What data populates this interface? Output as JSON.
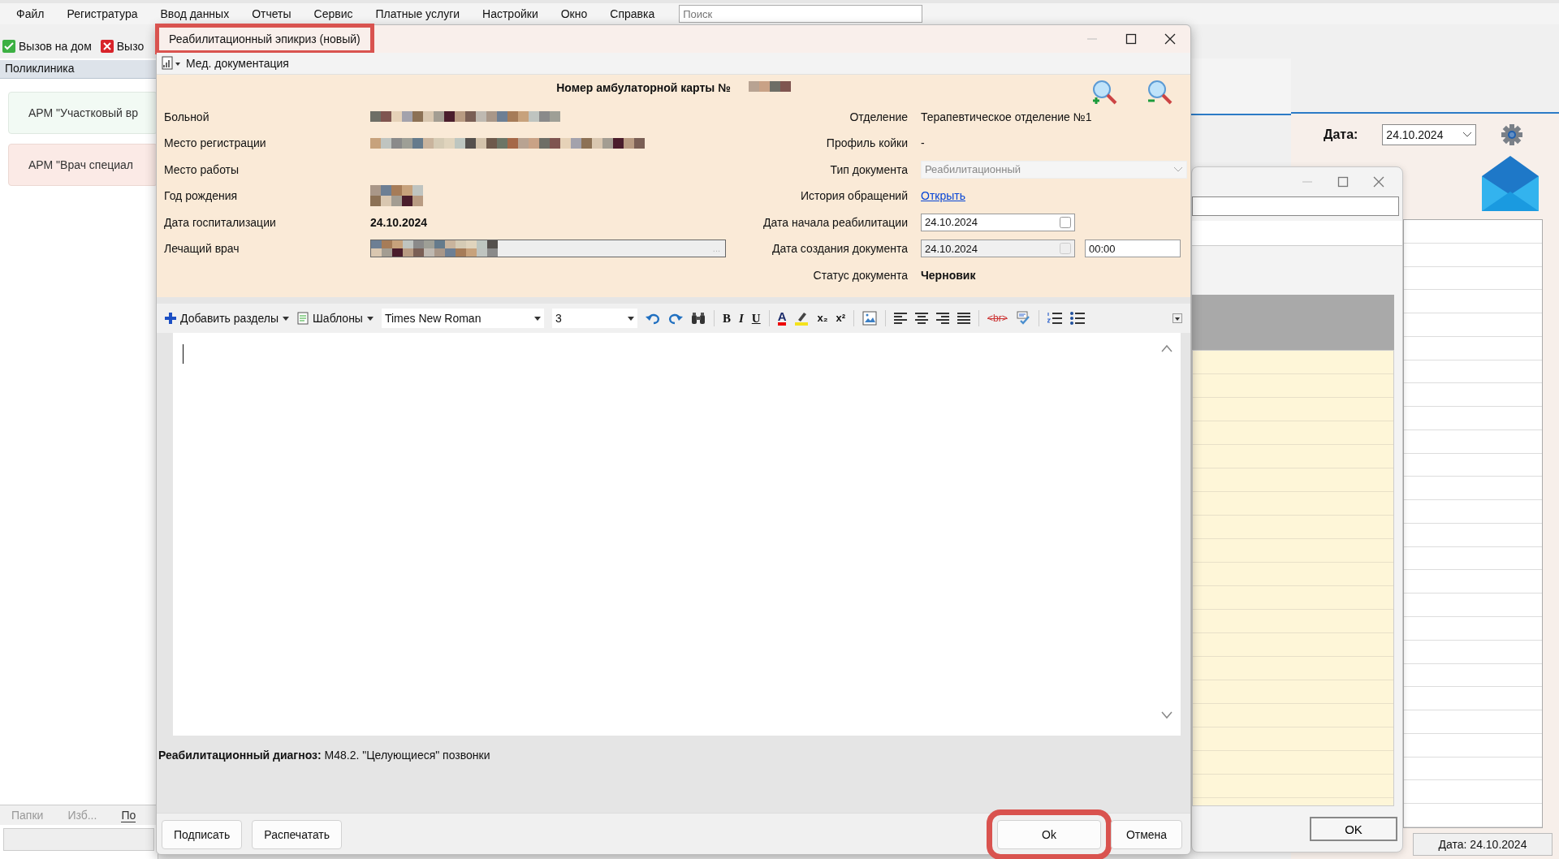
{
  "main_window": {
    "menu": [
      "Файл",
      "Регистратура",
      "Ввод данных",
      "Отчеты",
      "Сервис",
      "Платные услуги",
      "Настройки",
      "Окно",
      "Справка"
    ],
    "search": {
      "placeholder": "Поиск"
    },
    "toolbar": [
      {
        "label": "Вызов на дом",
        "kind": "call-home"
      },
      {
        "label": "Вызо",
        "kind": "call-cancel"
      }
    ],
    "panel_title": "Поликлиника",
    "workplaces": [
      "АРМ \"Участковый вр",
      "АРМ \"Врач специал"
    ],
    "bottom_tabs": [
      {
        "label": "Папки",
        "selected": false
      },
      {
        "label": "Изб...",
        "selected": false
      },
      {
        "label": "По",
        "selected": true
      }
    ],
    "date_label": "Дата:",
    "date_value": "24.10.2024",
    "status_bar": "Дата: 24.10.2024"
  },
  "back_dialog": {
    "ok_button": "OK"
  },
  "dialog": {
    "title": "Реабилитационный эпикриз (новый)",
    "title_highlighted": true,
    "menu": "Мед. документация",
    "card_number_label": "Номер амбулаторной карты №",
    "left_fields": [
      {
        "label": "Больной",
        "kind": "redacted"
      },
      {
        "label": "Место регистрации",
        "kind": "redacted"
      },
      {
        "label": "Место работы",
        "kind": "empty"
      },
      {
        "label": "Год рождения",
        "kind": "redacted"
      },
      {
        "label": "Дата госпитализации",
        "kind": "bold",
        "value": "24.10.2024"
      },
      {
        "label": "Лечащий врач",
        "kind": "picker",
        "button": "..."
      }
    ],
    "right_fields": [
      {
        "label": "Отделение",
        "kind": "text",
        "value": "Терапевтическое отделение №1"
      },
      {
        "label": "Профиль койки",
        "kind": "text",
        "value": "-"
      },
      {
        "label": "Тип документа",
        "kind": "combo",
        "value": "Реабилитационный",
        "disabled": true
      },
      {
        "label": "История обращений",
        "kind": "link",
        "value": "Открыть"
      },
      {
        "label": "Дата начала реабилитации",
        "kind": "date",
        "value": "24.10.2024",
        "disabled": false
      },
      {
        "label": "Дата создания документа",
        "kind": "datetime",
        "value": "24.10.2024",
        "time": "00:00",
        "disabled": true
      },
      {
        "label": "Статус документа",
        "kind": "bold",
        "value": "Черновик"
      }
    ],
    "toolbar": [
      {
        "kind": "add",
        "label": "Добавить разделы"
      },
      {
        "kind": "templates",
        "label": "Шаблоны"
      },
      {
        "kind": "font",
        "value": "Times New Roman"
      },
      {
        "kind": "size",
        "value": "3"
      },
      {
        "kind": "undo"
      },
      {
        "kind": "redo"
      },
      {
        "kind": "find"
      },
      {
        "kind": "sep"
      },
      {
        "kind": "bold",
        "label": "B"
      },
      {
        "kind": "italic",
        "label": "I"
      },
      {
        "kind": "underline",
        "label": "U"
      },
      {
        "kind": "sep"
      },
      {
        "kind": "color",
        "label": "A"
      },
      {
        "kind": "highlight"
      },
      {
        "kind": "sub",
        "label": "x₂"
      },
      {
        "kind": "sup",
        "label": "x²"
      },
      {
        "kind": "sep"
      },
      {
        "kind": "image"
      },
      {
        "kind": "sep"
      },
      {
        "kind": "align-left"
      },
      {
        "kind": "align-center"
      },
      {
        "kind": "align-right"
      },
      {
        "kind": "justify"
      },
      {
        "kind": "sep"
      },
      {
        "kind": "br",
        "label": "<br>"
      },
      {
        "kind": "spell"
      },
      {
        "kind": "sep"
      },
      {
        "kind": "ordered"
      },
      {
        "kind": "bullets"
      }
    ],
    "diagnosis": "**Реабилитационный диагноз:** M48.2. \"Целующиеся\" позвонки",
    "left_buttons": [
      {
        "label": "Подписать",
        "highlighted": false
      },
      {
        "label": "Распечатать",
        "highlighted": false
      }
    ],
    "right_buttons": [
      {
        "label": "Ok",
        "highlighted": true
      },
      {
        "label": "Отмена",
        "highlighted": false
      }
    ]
  }
}
